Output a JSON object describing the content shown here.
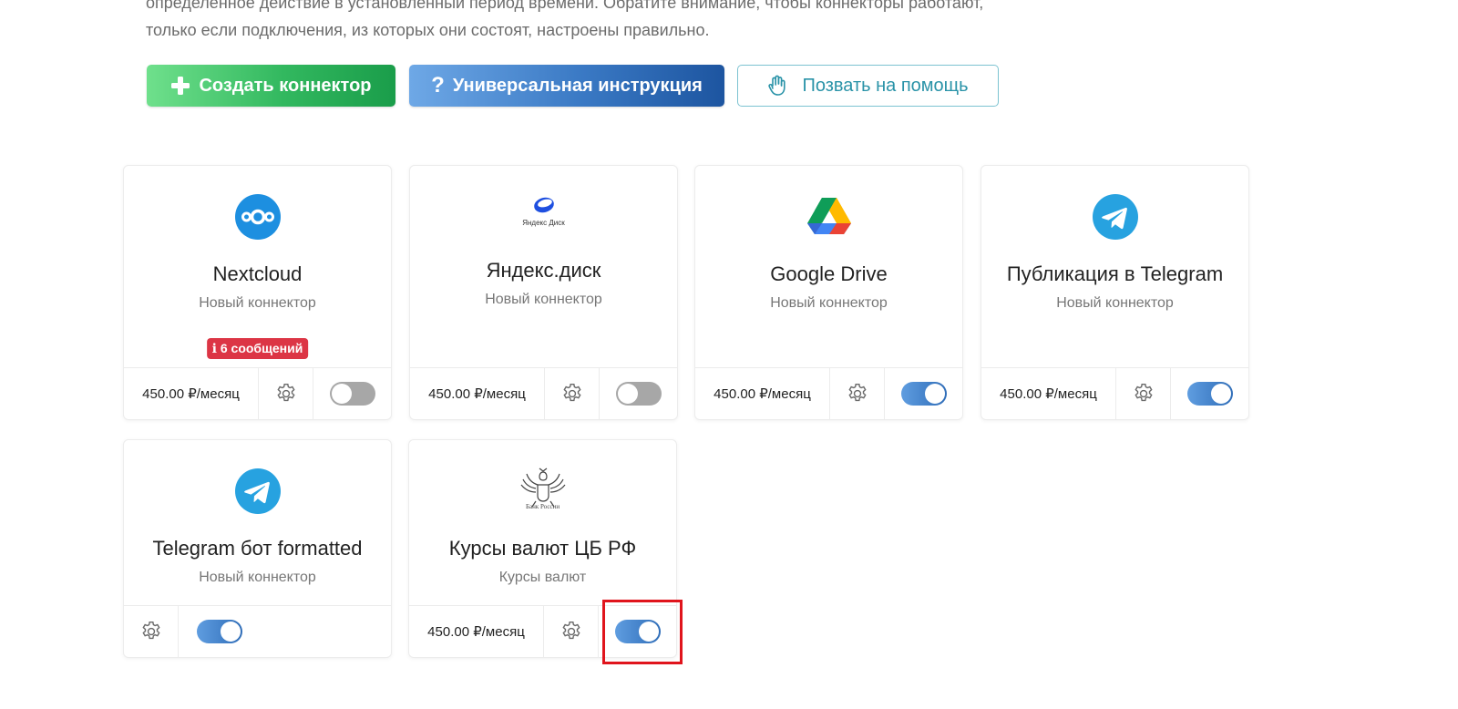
{
  "intro": {
    "line1": "определенное действие в установленный период времени. Обратите внимание, чтобы коннекторы работают,",
    "line2": "только если подключения, из которых они состоят, настроены правильно."
  },
  "actions": {
    "create_label": "Создать коннектор",
    "guide_label": "Универсальная инструкция",
    "help_label": "Позвать на помощь"
  },
  "cards": [
    {
      "title": "Nextcloud",
      "subtitle": "Новый коннектор",
      "badge": "6 сообщений",
      "price": "450.00 ₽/месяц",
      "enabled": false,
      "icon": "nextcloud-logo"
    },
    {
      "title": "Яндекс.диск",
      "subtitle": "Новый коннектор",
      "logo_text": "Яндекс Диск",
      "price": "450.00 ₽/месяц",
      "enabled": false,
      "icon": "yandex-disk-logo"
    },
    {
      "title": "Google Drive",
      "subtitle": "Новый коннектор",
      "price": "450.00 ₽/месяц",
      "enabled": true,
      "icon": "google-drive-logo"
    },
    {
      "title": "Публикация в Telegram",
      "subtitle": "Новый коннектор",
      "price": "450.00 ₽/месяц",
      "enabled": true,
      "icon": "telegram-logo"
    },
    {
      "title": "Telegram бот formatted",
      "subtitle": "Новый коннектор",
      "enabled": true,
      "icon": "telegram-logo"
    },
    {
      "title": "Курсы валют ЦБ РФ",
      "subtitle": "Курсы валют",
      "logo_text": "Банк России",
      "price": "450.00 ₽/месяц",
      "enabled": true,
      "icon": "bank-of-russia-emblem"
    }
  ],
  "colors": {
    "create_button": "#32b85f",
    "guide_button": "#3a79c4",
    "help_border": "#7cc3d1",
    "badge": "#dc3545",
    "toggle_on": "#3a79c4",
    "toggle_off": "#a7a7a7",
    "highlight": "#e0141c"
  }
}
